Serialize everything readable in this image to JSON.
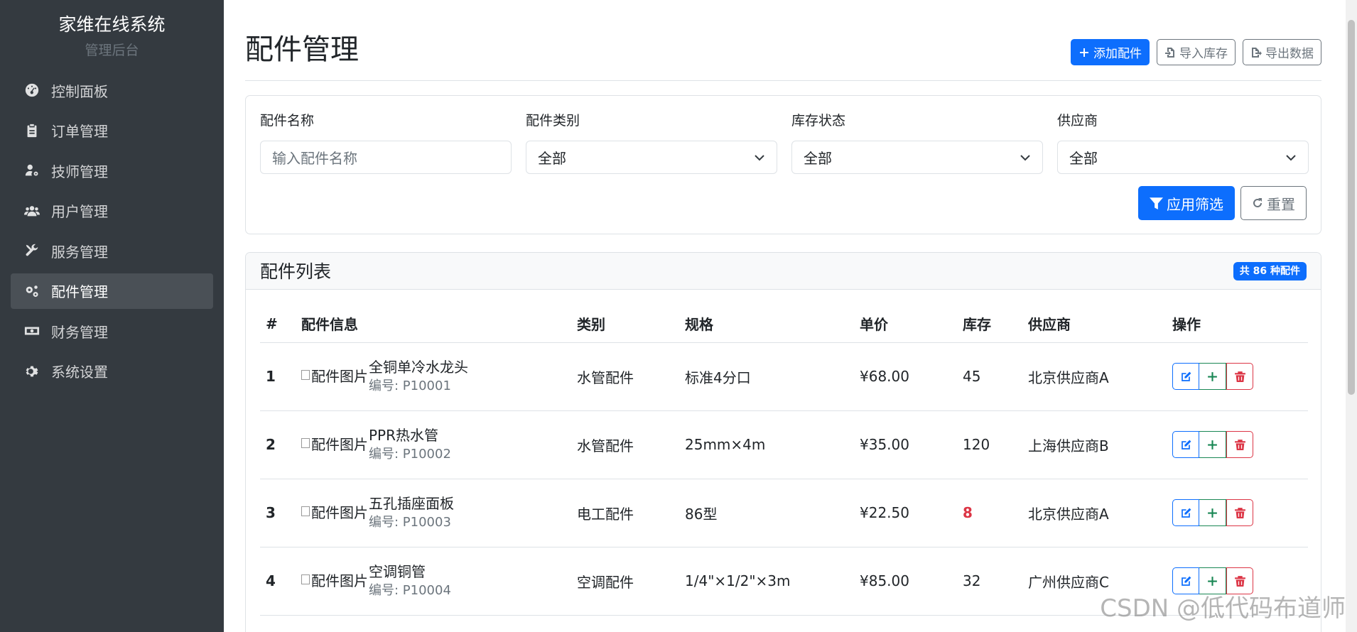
{
  "sidebar": {
    "title": "家维在线系统",
    "subtitle": "管理后台",
    "items": [
      {
        "label": "控制面板",
        "icon": "dashboard-icon"
      },
      {
        "label": "订单管理",
        "icon": "clipboard-icon"
      },
      {
        "label": "技师管理",
        "icon": "user-gear-icon"
      },
      {
        "label": "用户管理",
        "icon": "users-icon"
      },
      {
        "label": "服务管理",
        "icon": "tools-icon"
      },
      {
        "label": "配件管理",
        "icon": "gears-icon",
        "active": true
      },
      {
        "label": "财务管理",
        "icon": "money-icon"
      },
      {
        "label": "系统设置",
        "icon": "gear-icon"
      }
    ]
  },
  "header": {
    "title": "配件管理",
    "add_label": "添加配件",
    "import_label": "导入库存",
    "export_label": "导出数据"
  },
  "filters": {
    "name_label": "配件名称",
    "name_placeholder": "输入配件名称",
    "category_label": "配件类别",
    "category_value": "全部",
    "stock_label": "库存状态",
    "stock_value": "全部",
    "supplier_label": "供应商",
    "supplier_value": "全部",
    "apply_label": "应用筛选",
    "reset_label": "重置"
  },
  "list": {
    "title": "配件列表",
    "count_badge": "共 86 种配件",
    "columns": [
      "#",
      "配件信息",
      "类别",
      "规格",
      "单价",
      "库存",
      "供应商",
      "操作"
    ],
    "img_alt": "配件图片",
    "rows": [
      {
        "idx": "1",
        "name": "全铜单冷水龙头",
        "code": "编号: P10001",
        "category": "水管配件",
        "spec": "标准4分口",
        "price": "¥68.00",
        "stock": "45",
        "supplier": "北京供应商A",
        "low": false
      },
      {
        "idx": "2",
        "name": "PPR热水管",
        "code": "编号: P10002",
        "category": "水管配件",
        "spec": "25mm×4m",
        "price": "¥35.00",
        "stock": "120",
        "supplier": "上海供应商B",
        "low": false
      },
      {
        "idx": "3",
        "name": "五孔插座面板",
        "code": "编号: P10003",
        "category": "电工配件",
        "spec": "86型",
        "price": "¥22.50",
        "stock": "8",
        "supplier": "北京供应商A",
        "low": true
      },
      {
        "idx": "4",
        "name": "空调铜管",
        "code": "编号: P10004",
        "category": "空调配件",
        "spec": "1/4\"×1/2\"×3m",
        "price": "¥85.00",
        "stock": "32",
        "supplier": "广州供应商C",
        "low": false
      }
    ]
  },
  "watermark": "CSDN @低代码布道师",
  "colors": {
    "sidebar_bg": "#343a40",
    "primary": "#0d6efd",
    "danger": "#dc3545",
    "success": "#198754",
    "secondary": "#6c757d"
  }
}
